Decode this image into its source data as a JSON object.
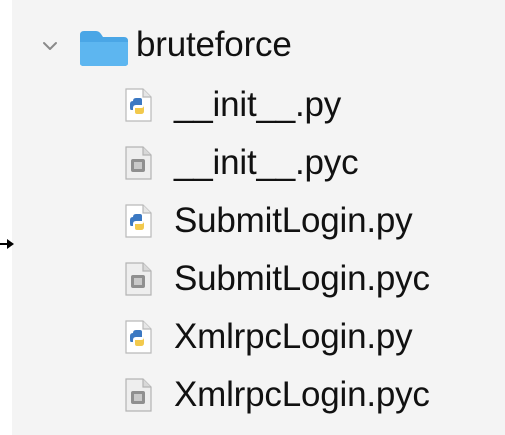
{
  "tree": {
    "cutoff_text": "...",
    "folder": {
      "name": "bruteforce",
      "expanded": true,
      "icon": "folder-icon",
      "color": "#3a9ad9"
    },
    "files": [
      {
        "name": "__init__.py",
        "type": "python-source",
        "icon": "python-file-icon"
      },
      {
        "name": "__init__.pyc",
        "type": "compiled",
        "icon": "compiled-file-icon"
      },
      {
        "name": "SubmitLogin.py",
        "type": "python-source",
        "icon": "python-file-icon"
      },
      {
        "name": "SubmitLogin.pyc",
        "type": "compiled",
        "icon": "compiled-file-icon"
      },
      {
        "name": "XmlrpcLogin.py",
        "type": "python-source",
        "icon": "python-file-icon"
      },
      {
        "name": "XmlrpcLogin.pyc",
        "type": "compiled",
        "icon": "compiled-file-icon"
      }
    ]
  },
  "pointer": {
    "icon": "arrow-pointer-icon"
  }
}
